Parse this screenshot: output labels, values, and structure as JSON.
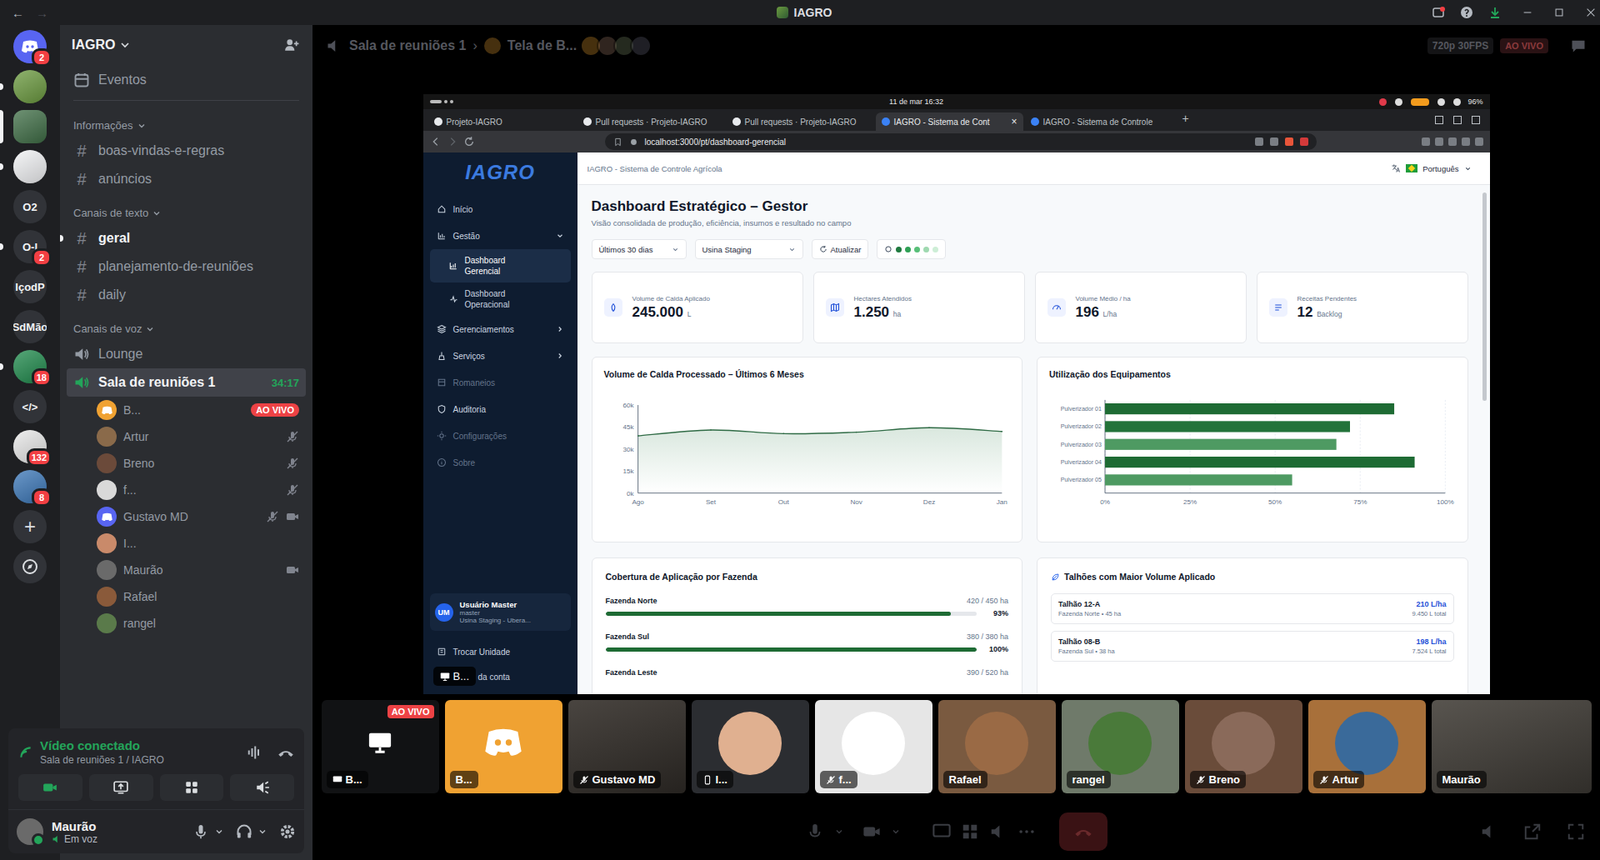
{
  "titlebar": {
    "title": "IAGRO",
    "back": "←",
    "forward": "→"
  },
  "servers": [
    {
      "kind": "home",
      "badge": "2",
      "unread": false,
      "selected": false,
      "color": "#5865f2"
    },
    {
      "kind": "image",
      "unread": true,
      "selected": false,
      "color": "#6b9a3f"
    },
    {
      "kind": "image",
      "unread": false,
      "selected": true,
      "color": "#3f6e46"
    },
    {
      "kind": "image",
      "unread": true,
      "selected": false,
      "color": "#f2f3f5"
    },
    {
      "kind": "text",
      "label": "O2",
      "unread": false,
      "selected": false,
      "color": "#313338"
    },
    {
      "kind": "text",
      "label": "O-I",
      "badge": "2",
      "unread": true,
      "selected": false,
      "color": "#313338"
    },
    {
      "kind": "text",
      "label": "IçodP",
      "unread": false,
      "selected": false,
      "color": "#313338"
    },
    {
      "kind": "text",
      "label": "SdMão",
      "unread": false,
      "selected": false,
      "color": "#313338"
    },
    {
      "kind": "image",
      "badge": "18",
      "unread": true,
      "selected": false,
      "color": "#1f8a4c"
    },
    {
      "kind": "text",
      "label": "</>",
      "unread": false,
      "selected": false,
      "color": "#313338"
    },
    {
      "kind": "image",
      "badge": "132",
      "unread": false,
      "selected": false,
      "color": "#e9e9e9"
    },
    {
      "kind": "image",
      "badge": "8",
      "unread": false,
      "selected": false,
      "color": "#3b77b8"
    },
    {
      "kind": "add",
      "label": "+",
      "unread": false,
      "selected": false,
      "color": "#313338"
    },
    {
      "kind": "explore",
      "unread": false,
      "selected": false,
      "color": "#313338"
    }
  ],
  "guild": {
    "name": "IAGRO",
    "events": "Eventos"
  },
  "categories": [
    {
      "name": "Informações",
      "channels": [
        {
          "name": "boas-vindas-e-regras",
          "symbol": "#",
          "unread": false
        },
        {
          "name": "anúncios",
          "symbol": "#",
          "unread": false
        }
      ]
    },
    {
      "name": "Canais de texto",
      "channels": [
        {
          "name": "geral",
          "symbol": "#",
          "unread": true
        },
        {
          "name": "planejamento-de-reuniões",
          "symbol": "#",
          "unread": false
        },
        {
          "name": "daily",
          "symbol": "#",
          "unread": false
        }
      ]
    }
  ],
  "voice": {
    "name": "Canais de voz",
    "channels": [
      {
        "name": "Lounge",
        "selected": false,
        "members": []
      },
      {
        "name": "Sala de reuniões 1",
        "selected": true,
        "timer": "34:17",
        "members": [
          {
            "name": "B...",
            "live": "AO VIVO",
            "muted": false,
            "camera": false,
            "logo": true,
            "color": "#f0a232"
          },
          {
            "name": "Artur",
            "muted": true,
            "camera": false,
            "logo": false,
            "color": "#8a6a4a"
          },
          {
            "name": "Breno",
            "muted": true,
            "camera": false,
            "logo": false,
            "color": "#6b4a3a"
          },
          {
            "name": "f...",
            "muted": true,
            "camera": false,
            "logo": false,
            "color": "#d9d9d9"
          },
          {
            "name": "Gustavo MD",
            "muted": true,
            "camera": true,
            "logo": true,
            "color": "#5865f2"
          },
          {
            "name": "I...",
            "muted": false,
            "camera": false,
            "logo": false,
            "color": "#c98a6a"
          },
          {
            "name": "Maurão",
            "muted": false,
            "camera": true,
            "logo": false,
            "color": "#6a6a6a"
          },
          {
            "name": "Rafael",
            "muted": false,
            "camera": false,
            "logo": false,
            "color": "#8a5a3a"
          },
          {
            "name": "rangel",
            "muted": false,
            "camera": false,
            "logo": false,
            "color": "#5a7a4a"
          }
        ]
      }
    ]
  },
  "panel": {
    "status": "Vídeo conectado",
    "location": "Sala de reuniões 1 / IAGRO",
    "user": {
      "name": "Maurão",
      "status": "Em voz"
    }
  },
  "stage": {
    "channel": "Sala de reuniões 1",
    "separator": "›",
    "stream": "Tela de B...",
    "viewers": [
      "#c98a2a",
      "#8a6a5a",
      "#6a7a5a",
      "#5a5a6a"
    ],
    "quality": "720p 30FPS",
    "live": "AO VIVO"
  },
  "stream_label": "B...",
  "browser": {
    "clock": "11 de mar  16:32",
    "battery": "96%",
    "tabs": [
      {
        "label": "Projeto-IAGRO",
        "selected": false
      },
      {
        "label": "Pull requests · Projeto-IAGRO",
        "selected": false
      },
      {
        "label": "Pull requests · Projeto-IAGRO",
        "selected": false
      },
      {
        "label": "IAGRO - Sistema de Cont",
        "selected": true,
        "close": "×"
      },
      {
        "label": "IAGRO - Sistema de Controle",
        "selected": false
      }
    ],
    "new_tab": "+",
    "url": "localhost:3000/pt/dashboard-gerencial"
  },
  "app": {
    "logo": "IAGRO",
    "nav": [
      {
        "label": "Início",
        "kind": "item",
        "selected": false,
        "disabled": false
      },
      {
        "label": "Gestão",
        "kind": "item",
        "selected": false,
        "disabled": false,
        "expanded": true
      },
      {
        "label": "Dashboard Gerencial",
        "kind": "sub",
        "selected": true,
        "disabled": false
      },
      {
        "label": "Dashboard Operacional",
        "kind": "sub",
        "selected": false,
        "disabled": false
      },
      {
        "label": "Gerenciamentos",
        "kind": "item",
        "selected": false,
        "disabled": false,
        "expanded": false
      },
      {
        "label": "Serviços",
        "kind": "item",
        "selected": false,
        "disabled": false,
        "expanded": false
      },
      {
        "label": "Romaneios",
        "kind": "item",
        "selected": false,
        "disabled": true
      },
      {
        "label": "Auditoria",
        "kind": "item",
        "selected": false,
        "disabled": false
      },
      {
        "label": "Configurações",
        "kind": "item",
        "selected": false,
        "disabled": true
      },
      {
        "label": "Sobre",
        "kind": "item",
        "selected": false,
        "disabled": true
      }
    ],
    "user": {
      "initials": "UM",
      "name": "Usuário Master",
      "role": "master",
      "unit": "Usina Staging - Ubera..."
    },
    "footer": [
      {
        "label": "Trocar Unidade",
        "covered": false
      },
      {
        "label": "da conta",
        "covered": true
      }
    ],
    "breadcrumb": "IAGRO - Sistema de Controle Agrícola",
    "language": "Português",
    "title": "Dashboard Estratégico – Gestor",
    "subtitle": "Visão consolidada de produção, eficiência, insumos e resultado no campo",
    "filters": [
      {
        "kind": "select",
        "label": "Últimos 30 dias"
      },
      {
        "kind": "select",
        "label": "Usina Staging"
      },
      {
        "kind": "button",
        "label": "Atualizar"
      },
      {
        "kind": "status",
        "dots": [
          "#1f7a3f",
          "#2ea055",
          "#58bf78",
          "#9fd9b0",
          "#cdeed6"
        ]
      }
    ],
    "kpis": [
      {
        "label": "Volume de Calda Aplicado",
        "value": "245.000",
        "unit": "L"
      },
      {
        "label": "Hectares Atendidos",
        "value": "1.250",
        "unit": "ha"
      },
      {
        "label": "Volume Médio / ha",
        "value": "196",
        "unit": "L/ha"
      },
      {
        "label": "Receitas Pendentes",
        "value": "12",
        "unit": "Backlog"
      }
    ],
    "line_chart": {
      "title": "Volume de Calda Processado – Últimos 6 Meses",
      "y_ticks": [
        "60k",
        "45k",
        "30k",
        "15k",
        "0k"
      ],
      "max": 60000,
      "x_labels": [
        "Ago",
        "Set",
        "Out",
        "Nov",
        "Dez",
        "Jan"
      ],
      "values": [
        39000,
        43000,
        40500,
        41500,
        44500,
        42000
      ]
    },
    "bar_chart": {
      "title": "Utilização dos Equipamentos",
      "x_ticks": [
        "0%",
        "25%",
        "50%",
        "75%",
        "100%"
      ],
      "max": 100,
      "bars": [
        {
          "label": "Pulverizador 01",
          "value": 85,
          "color": "#1e6b34"
        },
        {
          "label": "Pulverizador 02",
          "value": 72,
          "color": "#23733a"
        },
        {
          "label": "Pulverizador 03",
          "value": 68,
          "color": "#4e9a62"
        },
        {
          "label": "Pulverizador 04",
          "value": 91,
          "color": "#1e6b34"
        },
        {
          "label": "Pulverizador 05",
          "value": 55,
          "color": "#4e9a62"
        }
      ]
    },
    "coverage": {
      "title": "Cobertura de Aplicação por Fazenda",
      "rows": [
        {
          "name": "Fazenda Norte",
          "reading": "420 / 450 ha",
          "percent": "93%",
          "level": 0.93
        },
        {
          "name": "Fazenda Sul",
          "reading": "380 / 380 ha",
          "percent": "100%",
          "level": 1.0
        },
        {
          "name": "Fazenda Leste",
          "reading": "390 / 520 ha"
        }
      ]
    },
    "plots": {
      "title": "Talhões com Maior Volume Aplicado",
      "rows": [
        {
          "name": "Talhão 12-A",
          "meta": "Fazenda Norte • 45 ha",
          "rate": "210 L/ha",
          "total": "9.450 L total"
        },
        {
          "name": "Talhão 08-B",
          "meta": "Fazenda Sul • 38 ha",
          "rate": "198 L/ha",
          "total": "7.524 L total"
        }
      ]
    }
  },
  "tiles": [
    {
      "name": "B...",
      "kind": "screen",
      "badge": "AO VIVO",
      "muted": false,
      "color": "#111214"
    },
    {
      "name": "B...",
      "kind": "avatar",
      "logo": true,
      "muted": false,
      "color": "#f0a232"
    },
    {
      "name": "Gustavo MD",
      "kind": "video",
      "muted": true,
      "color": "#3a3530"
    },
    {
      "name": "I...",
      "kind": "avatar",
      "mobile": true,
      "muted": false,
      "color": "#2b2d31",
      "avatar": "#e0b090"
    },
    {
      "name": "f...",
      "kind": "avatar",
      "muted": true,
      "color": "#e6e6e6",
      "avatar": "#ffffff"
    },
    {
      "name": "Rafael",
      "kind": "avatar",
      "muted": false,
      "color": "#7a5a40",
      "avatar": "#9a6a45"
    },
    {
      "name": "rangel",
      "kind": "avatar",
      "muted": false,
      "color": "#6f7a6a",
      "avatar": "#4a7a3a"
    },
    {
      "name": "Breno",
      "kind": "avatar",
      "muted": true,
      "color": "#6a4c3a",
      "avatar": "#8a6a5a"
    },
    {
      "name": "Artur",
      "kind": "avatar",
      "muted": true,
      "color": "#a8703a",
      "avatar": "#3a6a9a"
    },
    {
      "name": "Maurão",
      "kind": "video",
      "muted": false,
      "color": "#4a4640"
    }
  ]
}
